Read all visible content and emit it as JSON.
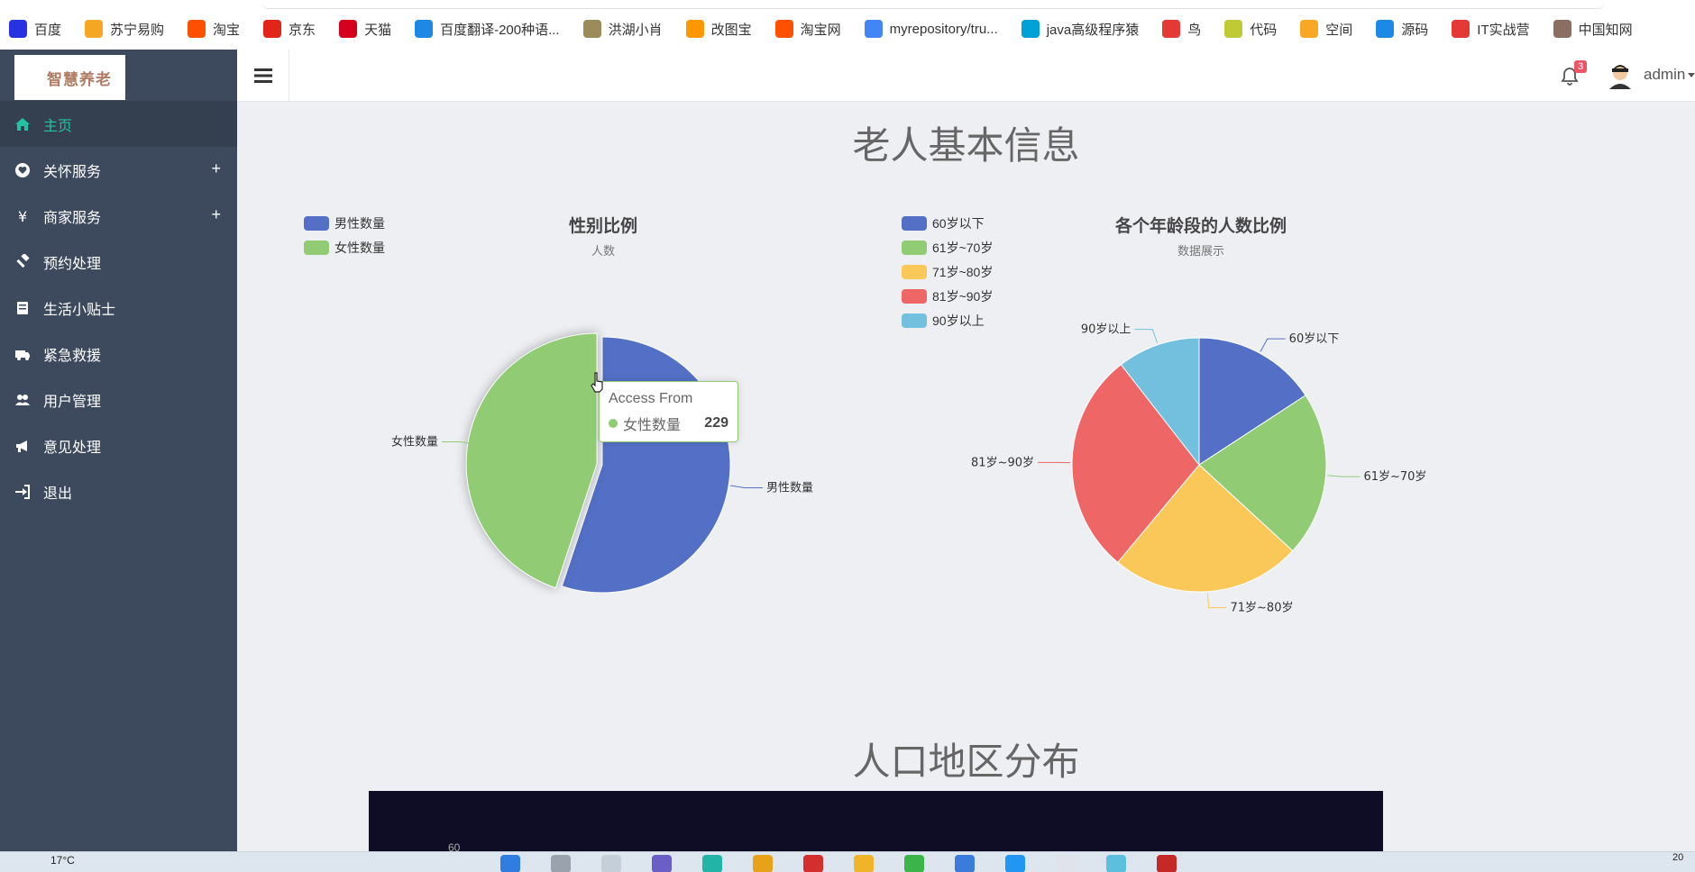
{
  "bookmarks": [
    {
      "label": "百度",
      "icon": "baidu-paw-icon",
      "color": "#2932e1"
    },
    {
      "label": "苏宁易购",
      "icon": "suning-lion-icon",
      "color": "#f5a623"
    },
    {
      "label": "淘宝",
      "icon": "taobao-icon",
      "color": "#ff5000"
    },
    {
      "label": "京东",
      "icon": "jd-icon",
      "color": "#e1251b"
    },
    {
      "label": "天猫",
      "icon": "tmall-icon",
      "color": "#d5001d"
    },
    {
      "label": "百度翻译-200种语...",
      "icon": "translate-icon",
      "color": "#1e88e5"
    },
    {
      "label": "洪湖小肖",
      "icon": "bird-icon",
      "color": "#9c8b5a"
    },
    {
      "label": "改图宝",
      "icon": "image-icon",
      "color": "#ff9800"
    },
    {
      "label": "淘宝网",
      "icon": "taobao-icon",
      "color": "#ff5000"
    },
    {
      "label": "myrepository/tru...",
      "icon": "chrome-icon",
      "color": "#4285f4"
    },
    {
      "label": "java高级程序猿",
      "icon": "bilibili-icon",
      "color": "#00a1d6"
    },
    {
      "label": "鸟",
      "icon": "bird-icon",
      "color": "#e53935"
    },
    {
      "label": "代码",
      "icon": "code-icon",
      "color": "#c0ca33"
    },
    {
      "label": "空间",
      "icon": "qzone-icon",
      "color": "#f9a825"
    },
    {
      "label": "源码",
      "icon": "fish-icon",
      "color": "#1e88e5"
    },
    {
      "label": "IT实战营",
      "icon": "chrome-icon",
      "color": "#e53935"
    },
    {
      "label": "中国知网",
      "icon": "cnki-icon",
      "color": "#8d6e63"
    }
  ],
  "logo": {
    "text": "智慧养老"
  },
  "sidebar": {
    "items": [
      {
        "label": "主页",
        "icon": "home-icon",
        "active": true,
        "expandable": false
      },
      {
        "label": "关怀服务",
        "icon": "heart-icon",
        "active": false,
        "expandable": true
      },
      {
        "label": "商家服务",
        "icon": "yen-icon",
        "active": false,
        "expandable": true
      },
      {
        "label": "预约处理",
        "icon": "gavel-icon",
        "active": false,
        "expandable": false
      },
      {
        "label": "生活小贴士",
        "icon": "book-icon",
        "active": false,
        "expandable": false
      },
      {
        "label": "紧急救援",
        "icon": "ambulance-icon",
        "active": false,
        "expandable": false
      },
      {
        "label": "用户管理",
        "icon": "users-icon",
        "active": false,
        "expandable": false
      },
      {
        "label": "意见处理",
        "icon": "megaphone-icon",
        "active": false,
        "expandable": false
      },
      {
        "label": "退出",
        "icon": "sign-in-icon",
        "active": false,
        "expandable": false
      }
    ],
    "plus_symbol": "+"
  },
  "header": {
    "notifications": "3",
    "username": "admin"
  },
  "main": {
    "title": "老人基本信息",
    "map_title": "人口地区分布",
    "map_axis_tick": "60"
  },
  "tooltip": {
    "title": "Access From",
    "series": "女性数量",
    "value": "229"
  },
  "chart_data": [
    {
      "type": "pie",
      "title": "性别比例",
      "subtitle": "人数",
      "legend_position": "top-left",
      "categories": [
        "男性数量",
        "女性数量"
      ],
      "values": [
        281,
        229
      ],
      "colors": [
        "#5470c6",
        "#91cc75"
      ],
      "highlighted": "女性数量"
    },
    {
      "type": "pie",
      "title": "各个年龄段的人数比例",
      "subtitle": "数据展示",
      "legend_position": "top-left",
      "categories": [
        "60岁以下",
        "61岁~70岁",
        "71岁~80岁",
        "81岁~90岁",
        "90岁以上"
      ],
      "values": [
        15,
        20,
        23,
        27,
        10
      ],
      "colors": [
        "#5470c6",
        "#91cc75",
        "#fac858",
        "#ee6666",
        "#73c0de"
      ]
    }
  ],
  "taskbar": {
    "weather": "17°C",
    "clock": "20"
  }
}
